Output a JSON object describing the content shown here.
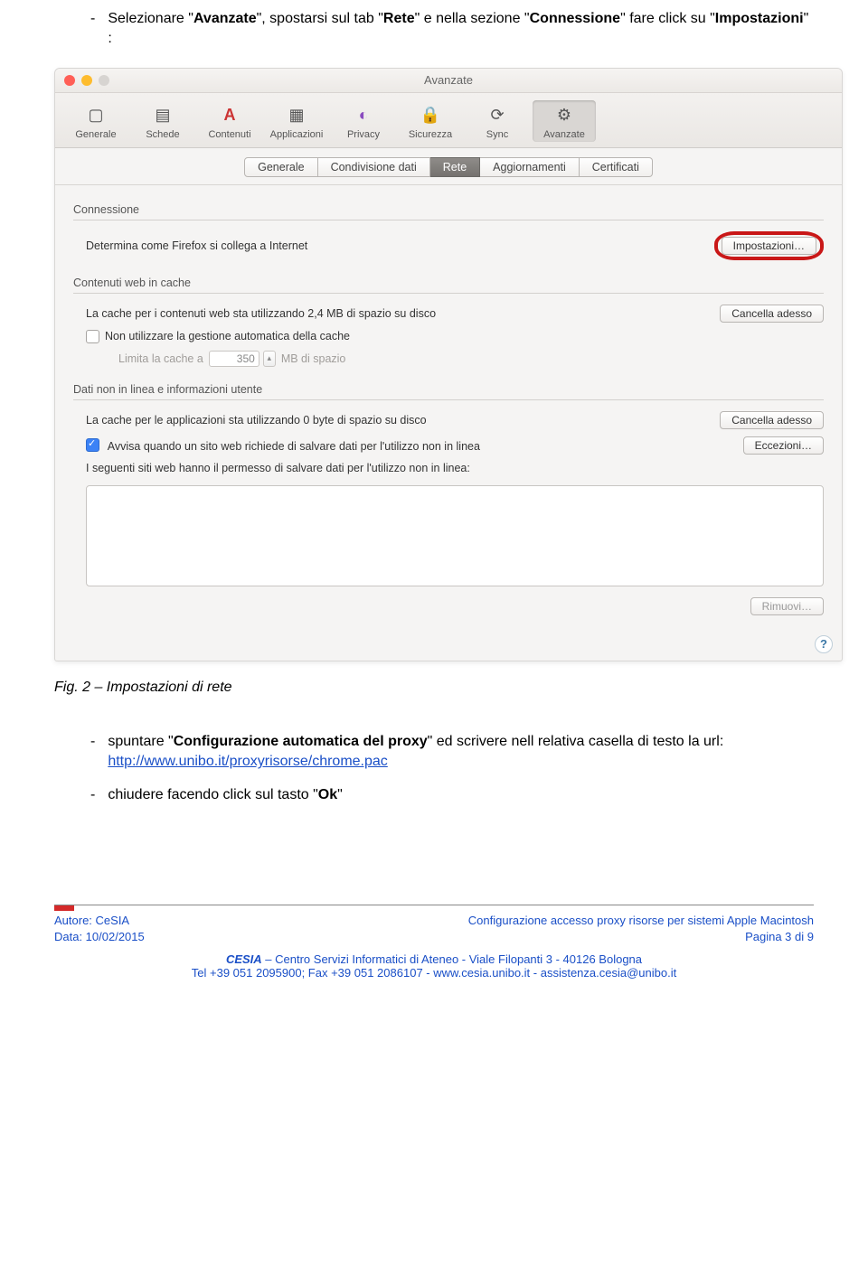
{
  "doc": {
    "intro_pre": "Selezionare \"",
    "intro_bold1": "Avanzate",
    "intro_mid1": "\", spostarsi sul tab \"",
    "intro_bold2": "Rete",
    "intro_mid2": "\" e nella sezione \"",
    "intro_bold3": "Connessione",
    "intro_mid3": "\" fare click su \"",
    "intro_bold4": "Impostazioni",
    "intro_post": "\" :",
    "caption": "Fig. 2 – Impostazioni di rete",
    "step2_pre": "spuntare \"",
    "step2_bold": "Configurazione automatica del proxy",
    "step2_mid": "\" ed scrivere nell relativa casella di testo la url: ",
    "step2_link": "http://www.unibo.it/proxyrisorse/chrome.pac",
    "step3_pre": "chiudere facendo click sul tasto \"",
    "step3_bold": "Ok",
    "step3_post": "\""
  },
  "window": {
    "title": "Avanzate",
    "toolbar": [
      {
        "label": "Generale",
        "glyph": "▢"
      },
      {
        "label": "Schede",
        "glyph": "▤"
      },
      {
        "label": "Contenuti",
        "glyph": "A"
      },
      {
        "label": "Applicazioni",
        "glyph": "▦"
      },
      {
        "label": "Privacy",
        "glyph": "◐"
      },
      {
        "label": "Sicurezza",
        "glyph": "🔒"
      },
      {
        "label": "Sync",
        "glyph": "⟳"
      },
      {
        "label": "Avanzate",
        "glyph": "⚙"
      }
    ],
    "tabs": [
      "Generale",
      "Condivisione dati",
      "Rete",
      "Aggiornamenti",
      "Certificati"
    ],
    "active_tab": "Rete",
    "conn": {
      "header": "Connessione",
      "label": "Determina come Firefox si collega a Internet",
      "button": "Impostazioni…"
    },
    "cache": {
      "header": "Contenuti web in cache",
      "label": "La cache per i contenuti web sta utilizzando 2,4 MB di spazio su disco",
      "button": "Cancella adesso",
      "no_auto": "Non utilizzare la gestione automatica della cache",
      "limit_lbl": "Limita la cache a",
      "limit_val": "350",
      "limit_unit": "MB di spazio"
    },
    "offline": {
      "header": "Dati non in linea e informazioni utente",
      "label": "La cache per le applicazioni sta utilizzando 0 byte di spazio su disco",
      "button": "Cancella adesso",
      "warn": "Avvisa quando un sito web richiede di salvare dati per l'utilizzo non in linea",
      "exceptions": "Eccezioni…",
      "perm": "I seguenti siti web hanno il permesso di salvare dati per l'utilizzo non in linea:",
      "remove": "Rimuovi…"
    },
    "help": "?"
  },
  "footer": {
    "author": "Autore: CeSIA",
    "date": "Data: 10/02/2015",
    "title": "Configurazione accesso proxy risorse per sistemi Apple Macintosh",
    "page": "Pagina 3 di 9",
    "org": "CESIA",
    "org_rest": " – Centro Servizi Informatici di Ateneo -  Viale Filopanti 3 - 40126 Bologna",
    "contact": "Tel +39 051 2095900; Fax +39 051 2086107 - www.cesia.unibo.it - assistenza.cesia@unibo.it"
  }
}
